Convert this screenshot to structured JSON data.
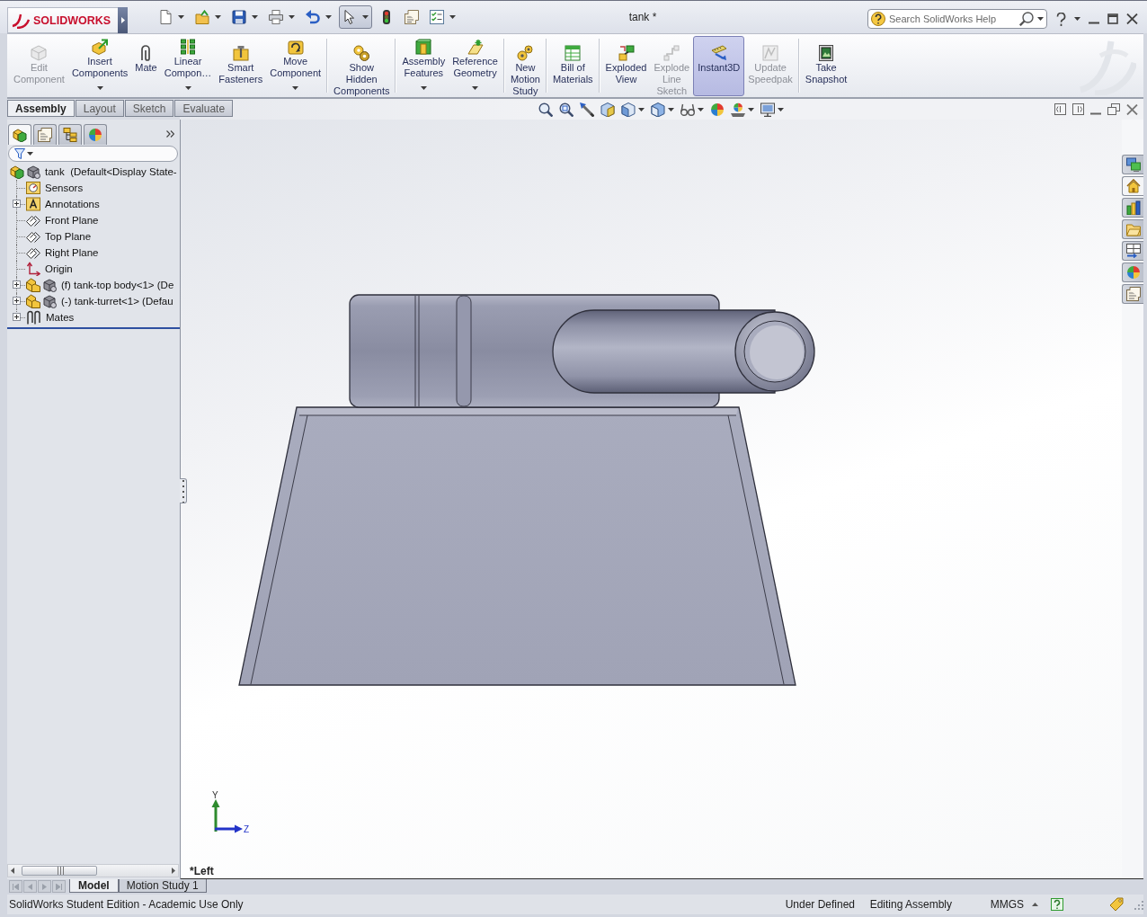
{
  "title_bar": {
    "app_name": "SOLIDWORKS",
    "document_title": "tank *",
    "search": {
      "placeholder": "Search SolidWorks Help"
    }
  },
  "quick_access_tools": [
    {
      "dropdown": true,
      "selected": false
    },
    {
      "dropdown": true,
      "selected": false
    },
    {
      "dropdown": true,
      "selected": false
    },
    {
      "dropdown": true,
      "selected": false
    },
    {
      "dropdown": true,
      "selected": false
    },
    {
      "dropdown": true,
      "selected": true
    },
    {
      "dropdown": false,
      "selected": false
    },
    {
      "dropdown": false,
      "selected": false
    },
    {
      "dropdown": true,
      "selected": false
    }
  ],
  "command_manager": {
    "groups": [
      {
        "buttons": [
          {
            "label": "Edit\nComponent",
            "disabled": true,
            "dropdown": false,
            "selected": false
          },
          {
            "label": "Insert\nComponents",
            "disabled": false,
            "dropdown": true,
            "selected": false
          },
          {
            "label": "Mate",
            "disabled": false,
            "dropdown": false,
            "selected": false
          },
          {
            "label": "Linear\nCompon…",
            "disabled": false,
            "dropdown": true,
            "selected": false
          },
          {
            "label": "Smart\nFasteners",
            "disabled": false,
            "dropdown": false,
            "selected": false
          },
          {
            "label": "Move\nComponent",
            "disabled": false,
            "dropdown": true,
            "selected": false
          }
        ]
      },
      {
        "buttons": [
          {
            "label": "Show\nHidden\nComponents",
            "disabled": false,
            "dropdown": false,
            "selected": false
          }
        ]
      },
      {
        "buttons": [
          {
            "label": "Assembly\nFeatures",
            "disabled": false,
            "dropdown": true,
            "selected": false
          },
          {
            "label": "Reference\nGeometry",
            "disabled": false,
            "dropdown": true,
            "selected": false
          }
        ]
      },
      {
        "buttons": [
          {
            "label": "New\nMotion\nStudy",
            "disabled": false,
            "dropdown": false,
            "selected": false
          }
        ]
      },
      {
        "buttons": [
          {
            "label": "Bill of\nMaterials",
            "disabled": false,
            "dropdown": false,
            "selected": false
          }
        ]
      },
      {
        "buttons": [
          {
            "label": "Exploded\nView",
            "disabled": false,
            "dropdown": false,
            "selected": false
          },
          {
            "label": "Explode\nLine\nSketch",
            "disabled": true,
            "dropdown": false,
            "selected": false
          },
          {
            "label": "Instant3D",
            "disabled": false,
            "dropdown": false,
            "selected": true
          },
          {
            "label": "Update\nSpeedpak",
            "disabled": true,
            "dropdown": false,
            "selected": false
          }
        ]
      },
      {
        "buttons": [
          {
            "label": "Take\nSnapshot",
            "disabled": false,
            "dropdown": false,
            "selected": false
          }
        ]
      }
    ],
    "tabs": [
      {
        "label": "Assembly",
        "selected": true
      },
      {
        "label": "Layout",
        "selected": false
      },
      {
        "label": "Sketch",
        "selected": false
      },
      {
        "label": "Evaluate",
        "selected": false
      }
    ]
  },
  "feature_manager": {
    "tabs": [
      {
        "selected": true
      },
      {
        "selected": false
      },
      {
        "selected": false
      },
      {
        "selected": false
      }
    ],
    "tree": {
      "label": "tank  (Default<Display State-",
      "kind": "assembly",
      "selected": false,
      "children": [
        {
          "label": "Sensors",
          "kind": "sensors",
          "selected": false
        },
        {
          "label": "Annotations",
          "kind": "annotations",
          "selected": false,
          "expanded": false
        },
        {
          "label": "Front Plane",
          "kind": "plane",
          "selected": false
        },
        {
          "label": "Top Plane",
          "kind": "plane",
          "selected": false
        },
        {
          "label": "Right Plane",
          "kind": "plane",
          "selected": false
        },
        {
          "label": "Origin",
          "kind": "origin",
          "selected": false
        },
        {
          "label": "(f) tank-top body<1> (De",
          "kind": "part",
          "selected": false,
          "expanded": false
        },
        {
          "label": "(-) tank-turret<1> (Defau",
          "kind": "part",
          "selected": false,
          "expanded": false
        },
        {
          "label": "Mates",
          "kind": "mates",
          "selected": false,
          "expanded": false
        }
      ]
    }
  },
  "graphics_area": {
    "view_name": "*Left",
    "triad": {
      "y_label": "Y",
      "z_label": "Z"
    }
  },
  "task_pane_tabs": [
    {
      "selected": false
    },
    {
      "selected": true
    },
    {
      "selected": false
    },
    {
      "selected": false
    },
    {
      "selected": false
    },
    {
      "selected": false
    },
    {
      "selected": false
    }
  ],
  "bottom_tabs": [
    {
      "label": "Model",
      "selected": true
    },
    {
      "label": "Motion Study 1",
      "selected": false
    }
  ],
  "status_bar": {
    "edition_text": "SolidWorks Student Edition - Academic Use Only",
    "fields": [
      "Under Defined",
      "Editing Assembly"
    ],
    "units": "MMGS"
  }
}
